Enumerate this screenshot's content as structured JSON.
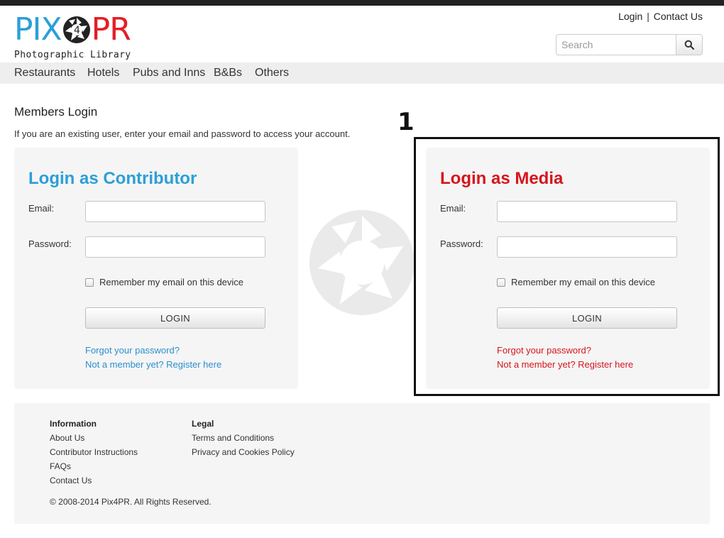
{
  "header": {
    "logo_text_left": "PIX",
    "logo_text_digit": "4",
    "logo_text_right": "PR",
    "logo_subtitle": "Photographic Library",
    "login_link": "Login",
    "separator": "|",
    "contact_link": "Contact Us",
    "search_placeholder": "Search",
    "search_icon": "search-icon"
  },
  "nav": {
    "items": [
      "Restaurants",
      "Hotels",
      "Pubs and Inns",
      "B&Bs",
      "Others"
    ]
  },
  "page": {
    "title": "Members Login",
    "intro": "If you are an existing user, enter your email and password to access your account."
  },
  "contributor": {
    "heading": "Login as Contributor",
    "email_label": "Email:",
    "email_value": "",
    "password_label": "Password:",
    "password_value": "",
    "remember_label": "Remember my email on this device",
    "remember_checked": false,
    "login_button": "LOGIN",
    "forgot_link": "Forgot your password?",
    "register_link": "Not a member yet? Register here",
    "accent_color": "#2b9fd8"
  },
  "media": {
    "heading": "Login as Media",
    "email_label": "Email:",
    "email_value": "",
    "password_label": "Password:",
    "password_value": "",
    "remember_label": "Remember my email on this device",
    "remember_checked": false,
    "login_button": "LOGIN",
    "forgot_link": "Forgot your password?",
    "register_link": "Not a member yet? Register here",
    "accent_color": "#d6151d"
  },
  "annotation": {
    "number": "1"
  },
  "footer": {
    "information": {
      "heading": "Information",
      "links": [
        "About Us",
        "Contributor Instructions",
        "FAQs",
        "Contact Us"
      ]
    },
    "legal": {
      "heading": "Legal",
      "links": [
        "Terms and Conditions",
        "Privacy and Cookies Policy"
      ]
    },
    "copyright": "© 2008-2014 Pix4PR. All Rights Reserved."
  }
}
